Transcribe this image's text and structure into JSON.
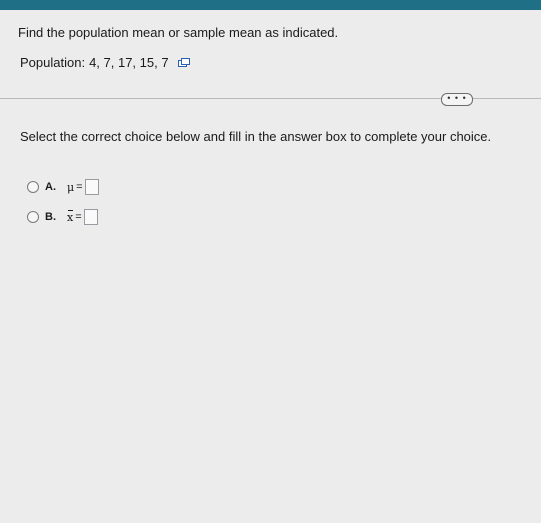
{
  "question": {
    "prompt": "Find the population mean or sample mean as indicated.",
    "population_label": "Population:",
    "population_values": "4, 7, 17, 15, 7"
  },
  "toolbar": {
    "more_label": "• • •"
  },
  "instruction": "Select the correct choice below and fill in the answer box to complete your choice.",
  "choices": [
    {
      "letter": "A.",
      "symbol": "μ",
      "equals": "=",
      "answer": ""
    },
    {
      "letter": "B.",
      "symbol": "x",
      "equals": "=",
      "answer": ""
    }
  ],
  "colors": {
    "topbar": "#1f6f86",
    "background": "#ececed"
  },
  "icons": {
    "copy": "copy-data-icon"
  }
}
